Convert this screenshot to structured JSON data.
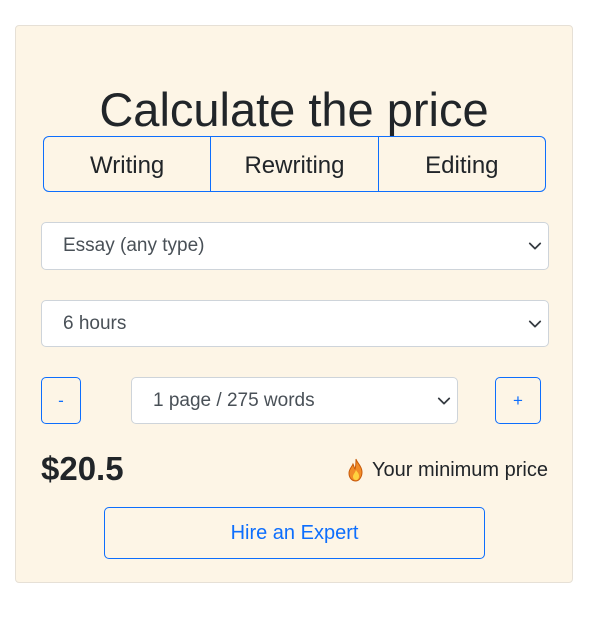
{
  "calculator": {
    "title": "Calculate the price",
    "service_tabs": [
      {
        "label": "Writing"
      },
      {
        "label": "Rewriting"
      },
      {
        "label": "Editing"
      }
    ],
    "paper_type": {
      "selected": "Essay (any type)"
    },
    "deadline": {
      "selected": "6 hours"
    },
    "pages": {
      "selected": "1 page / 275 words",
      "decrement_label": "-",
      "increment_label": "+"
    },
    "price": "$20.5",
    "min_price_note": "Your minimum price",
    "hire_button_label": "Hire an Expert"
  },
  "colors": {
    "card_background": "#fdf5e6",
    "accent": "#0d6efd",
    "text": "#212529"
  },
  "icons": {
    "select_chevron": "chevron-down-icon",
    "min_price": "fire-icon"
  }
}
